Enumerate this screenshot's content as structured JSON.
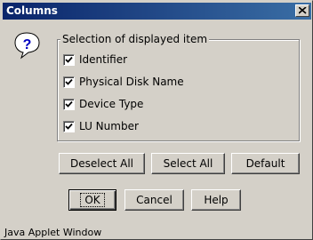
{
  "window": {
    "title": "Columns"
  },
  "icons": {
    "help": "question-icon",
    "close": "close-icon",
    "check": "check-icon"
  },
  "colors": {
    "titlebar_start": "#0a246a",
    "titlebar_end": "#3a6ea5",
    "face": "#d4d0c8"
  },
  "group": {
    "label": "Selection of displayed item",
    "items": [
      {
        "label": "Identifier",
        "checked": true
      },
      {
        "label": "Physical Disk Name",
        "checked": true
      },
      {
        "label": "Device Type",
        "checked": true
      },
      {
        "label": "LU Number",
        "checked": true
      }
    ]
  },
  "selection_buttons": {
    "deselect_all": "Deselect All",
    "select_all": "Select All",
    "default": "Default"
  },
  "dialog_buttons": {
    "ok": "OK",
    "cancel": "Cancel",
    "help": "Help"
  },
  "status": "Java Applet Window"
}
